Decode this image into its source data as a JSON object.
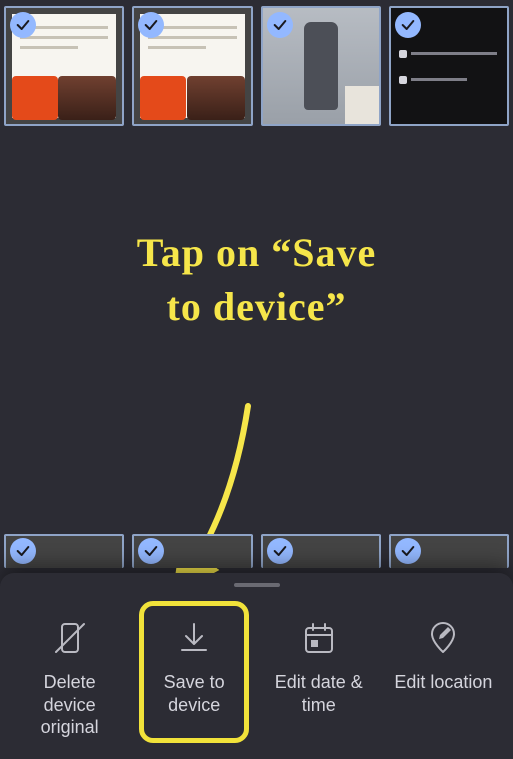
{
  "annotation": {
    "line1": "Tap on “Save",
    "line2": "to device”"
  },
  "sheet": {
    "actions": {
      "delete": {
        "label": "Delete device original"
      },
      "save": {
        "label": "Save to device"
      },
      "editdate": {
        "label": "Edit date & time"
      },
      "editloc": {
        "label": "Edit location"
      }
    }
  },
  "highlighted_action": "save"
}
